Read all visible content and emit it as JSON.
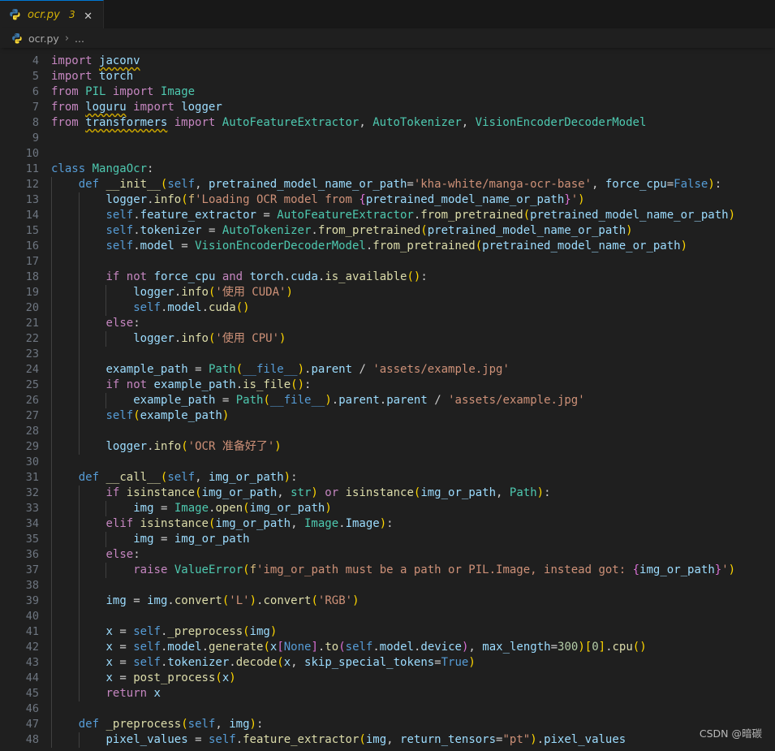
{
  "tab": {
    "icon": "python-file-icon",
    "label": "ocr.py",
    "badge": "3",
    "close_glyph": "✕"
  },
  "breadcrumbs": {
    "icon": "python-file-icon",
    "file": "ocr.py",
    "separator": "›",
    "ellipsis": "..."
  },
  "watermark": "CSDN @暗碳",
  "colors": {
    "editor_background": "#1f1f1f",
    "tabbar_background": "#181818",
    "active_tab_border": "#0078d4",
    "modified_tab_text": "#d4b106",
    "line_number": "#6e7681",
    "indent_guide": "#404040",
    "warning_squiggle": "#cca700",
    "keyword_control": "#c586c0",
    "keyword_declaration": "#569cd6",
    "type": "#4ec9b0",
    "function": "#dcdcaa",
    "variable": "#9cdcfe",
    "string": "#ce9178",
    "number": "#b5cea8",
    "foreground": "#cccccc"
  },
  "editor": {
    "first_visible_line": 4,
    "last_visible_line": 48,
    "lines": [
      {
        "n": 4,
        "text": "import jaconv"
      },
      {
        "n": 5,
        "text": "import torch"
      },
      {
        "n": 6,
        "text": "from PIL import Image"
      },
      {
        "n": 7,
        "text": "from loguru import logger"
      },
      {
        "n": 8,
        "text": "from transformers import AutoFeatureExtractor, AutoTokenizer, VisionEncoderDecoderModel"
      },
      {
        "n": 9,
        "text": ""
      },
      {
        "n": 10,
        "text": ""
      },
      {
        "n": 11,
        "text": "class MangaOcr:"
      },
      {
        "n": 12,
        "text": "    def __init__(self, pretrained_model_name_or_path='kha-white/manga-ocr-base', force_cpu=False):"
      },
      {
        "n": 13,
        "text": "        logger.info(f'Loading OCR model from {pretrained_model_name_or_path}')"
      },
      {
        "n": 14,
        "text": "        self.feature_extractor = AutoFeatureExtractor.from_pretrained(pretrained_model_name_or_path)"
      },
      {
        "n": 15,
        "text": "        self.tokenizer = AutoTokenizer.from_pretrained(pretrained_model_name_or_path)"
      },
      {
        "n": 16,
        "text": "        self.model = VisionEncoderDecoderModel.from_pretrained(pretrained_model_name_or_path)"
      },
      {
        "n": 17,
        "text": ""
      },
      {
        "n": 18,
        "text": "        if not force_cpu and torch.cuda.is_available():"
      },
      {
        "n": 19,
        "text": "            logger.info('使用 CUDA')"
      },
      {
        "n": 20,
        "text": "            self.model.cuda()"
      },
      {
        "n": 21,
        "text": "        else:"
      },
      {
        "n": 22,
        "text": "            logger.info('使用 CPU')"
      },
      {
        "n": 23,
        "text": ""
      },
      {
        "n": 24,
        "text": "        example_path = Path(__file__).parent / 'assets/example.jpg'"
      },
      {
        "n": 25,
        "text": "        if not example_path.is_file():"
      },
      {
        "n": 26,
        "text": "            example_path = Path(__file__).parent.parent / 'assets/example.jpg'"
      },
      {
        "n": 27,
        "text": "        self(example_path)"
      },
      {
        "n": 28,
        "text": ""
      },
      {
        "n": 29,
        "text": "        logger.info('OCR 准备好了')"
      },
      {
        "n": 30,
        "text": ""
      },
      {
        "n": 31,
        "text": "    def __call__(self, img_or_path):"
      },
      {
        "n": 32,
        "text": "        if isinstance(img_or_path, str) or isinstance(img_or_path, Path):"
      },
      {
        "n": 33,
        "text": "            img = Image.open(img_or_path)"
      },
      {
        "n": 34,
        "text": "        elif isinstance(img_or_path, Image.Image):"
      },
      {
        "n": 35,
        "text": "            img = img_or_path"
      },
      {
        "n": 36,
        "text": "        else:"
      },
      {
        "n": 37,
        "text": "            raise ValueError(f'img_or_path must be a path or PIL.Image, instead got: {img_or_path}')"
      },
      {
        "n": 38,
        "text": ""
      },
      {
        "n": 39,
        "text": "        img = img.convert('L').convert('RGB')"
      },
      {
        "n": 40,
        "text": ""
      },
      {
        "n": 41,
        "text": "        x = self._preprocess(img)"
      },
      {
        "n": 42,
        "text": "        x = self.model.generate(x[None].to(self.model.device), max_length=300)[0].cpu()"
      },
      {
        "n": 43,
        "text": "        x = self.tokenizer.decode(x, skip_special_tokens=True)"
      },
      {
        "n": 44,
        "text": "        x = post_process(x)"
      },
      {
        "n": 45,
        "text": "        return x"
      },
      {
        "n": 46,
        "text": ""
      },
      {
        "n": 47,
        "text": "    def _preprocess(self, img):"
      },
      {
        "n": 48,
        "text": "        pixel_values = self.feature_extractor(img, return_tensors=\"pt\").pixel_values"
      }
    ],
    "warnings": [
      {
        "line": 4,
        "token": "jaconv"
      },
      {
        "line": 7,
        "token": "loguru"
      },
      {
        "line": 8,
        "token": "transformers"
      }
    ]
  }
}
